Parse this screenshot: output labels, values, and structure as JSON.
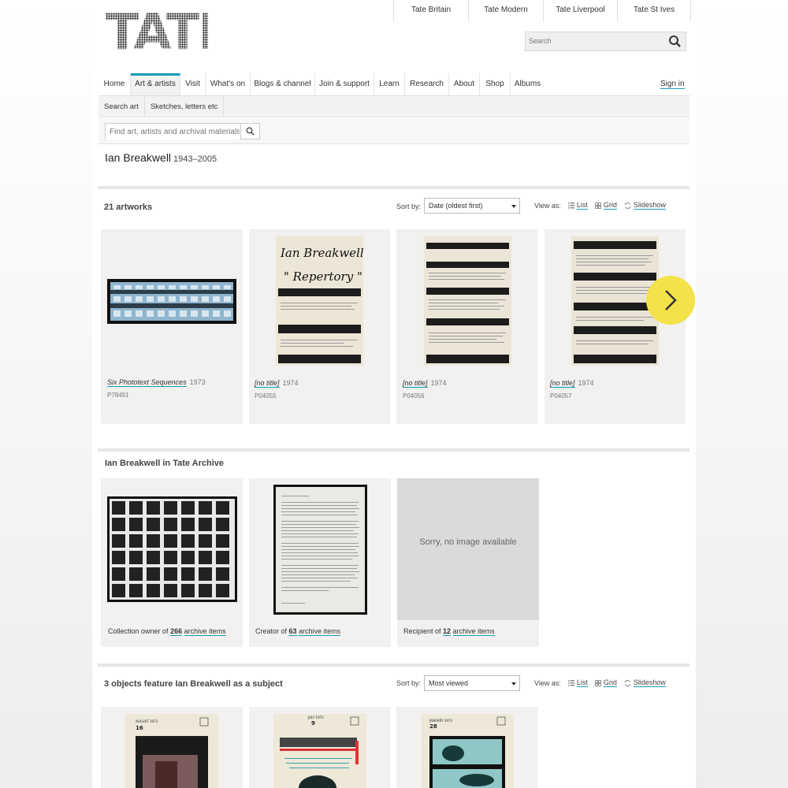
{
  "header": {
    "logo_text": "TATE",
    "sites": [
      "Tate Britain",
      "Tate Modern",
      "Tate Liverpool",
      "Tate St Ives"
    ],
    "search_placeholder": "Search"
  },
  "nav": {
    "items": [
      "Home",
      "Art & artists",
      "Visit",
      "What's on",
      "Blogs & channel",
      "Join & support",
      "Learn",
      "Research",
      "About",
      "Shop",
      "Albums"
    ],
    "active": "Art & artists",
    "signin": "Sign in"
  },
  "subnav": {
    "items": [
      "Search art",
      "Sketches, letters etc"
    ]
  },
  "find": {
    "placeholder": "Find art, artists and archival materials"
  },
  "artist": {
    "name": "Ian Breakwell",
    "dates": "1943–2005"
  },
  "artworks": {
    "heading": "21 artworks",
    "sort_label": "Sort by:",
    "sort_value": "Date (oldest first)",
    "view_label": "View as:",
    "view_options": [
      "List",
      "Grid",
      "Slideshow"
    ],
    "items": [
      {
        "title": "Six Phototext Sequences",
        "year": "1973",
        "acc": "P78491"
      },
      {
        "title": "[no title]",
        "year": "1974",
        "acc": "P04055"
      },
      {
        "title": "[no title]",
        "year": "1974",
        "acc": "P04056"
      },
      {
        "title": "[no title]",
        "year": "1974",
        "acc": "P04057"
      }
    ],
    "card2_handwriting": [
      "Ian Breakwell",
      "\" Repertory \""
    ]
  },
  "archive": {
    "heading": "Ian Breakwell in Tate Archive",
    "items": [
      {
        "prefix": "Collection owner of",
        "count": "266",
        "suffix": "archive items"
      },
      {
        "prefix": "Creator of",
        "count": "63",
        "suffix": "archive items"
      },
      {
        "prefix": "Recipient of",
        "count": "12",
        "suffix": "archive items"
      }
    ],
    "no_image": "Sorry, no image available"
  },
  "subjects": {
    "heading": "3 objects feature Ian Breakwell as a subject",
    "sort_label": "Sort by:",
    "sort_value": "Most viewed",
    "view_label": "View as:",
    "view_options": [
      "List",
      "Grid",
      "Slideshow"
    ],
    "thumb_labels": [
      "AUGUST 1973",
      "JULY 1973",
      "JANUARY 1973"
    ]
  },
  "colors": {
    "accent": "#1a9cb8",
    "next_button": "#f4e24a",
    "card_bg": "#f2f1ef"
  }
}
